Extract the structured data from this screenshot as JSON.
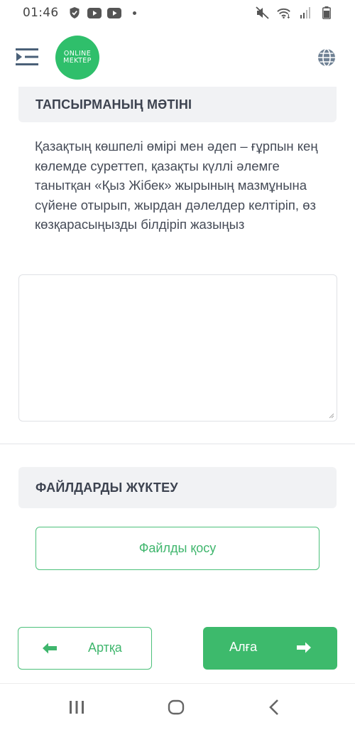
{
  "status_bar": {
    "time": "01:46",
    "left_icons": [
      "shield-check-icon",
      "youtube-icon",
      "youtube-icon",
      "dot-icon"
    ],
    "right_icons": [
      "mute-icon",
      "wifi-icon",
      "signal-icon",
      "battery-icon"
    ]
  },
  "header": {
    "logo_line1": "ONLINE",
    "logo_line2": "MEKTEP",
    "brand_color": "#2fbf6b"
  },
  "task_section": {
    "title": "ТАПСЫРМАНЫҢ МӘТІНІ",
    "text": "Қазақтың көшпелі өмірі мен әдеп – ғұрпын кең көлемде суреттеп, қазақты күллі әлемге танытқан «Қыз Жібек» жырының мазмұнына сүйене отырып, жырдан дәлелдер келтіріп, өз көзқарасыңызды білдіріп жазыңыз"
  },
  "answer": {
    "value": "",
    "placeholder": ""
  },
  "upload_section": {
    "title": "ФАЙЛДАРДЫ ЖҮКТЕУ",
    "add_file_label": "Файлды қосу"
  },
  "navigation": {
    "back_label": "Артқа",
    "next_label": "Алға",
    "accent_color": "#3dba6c"
  }
}
